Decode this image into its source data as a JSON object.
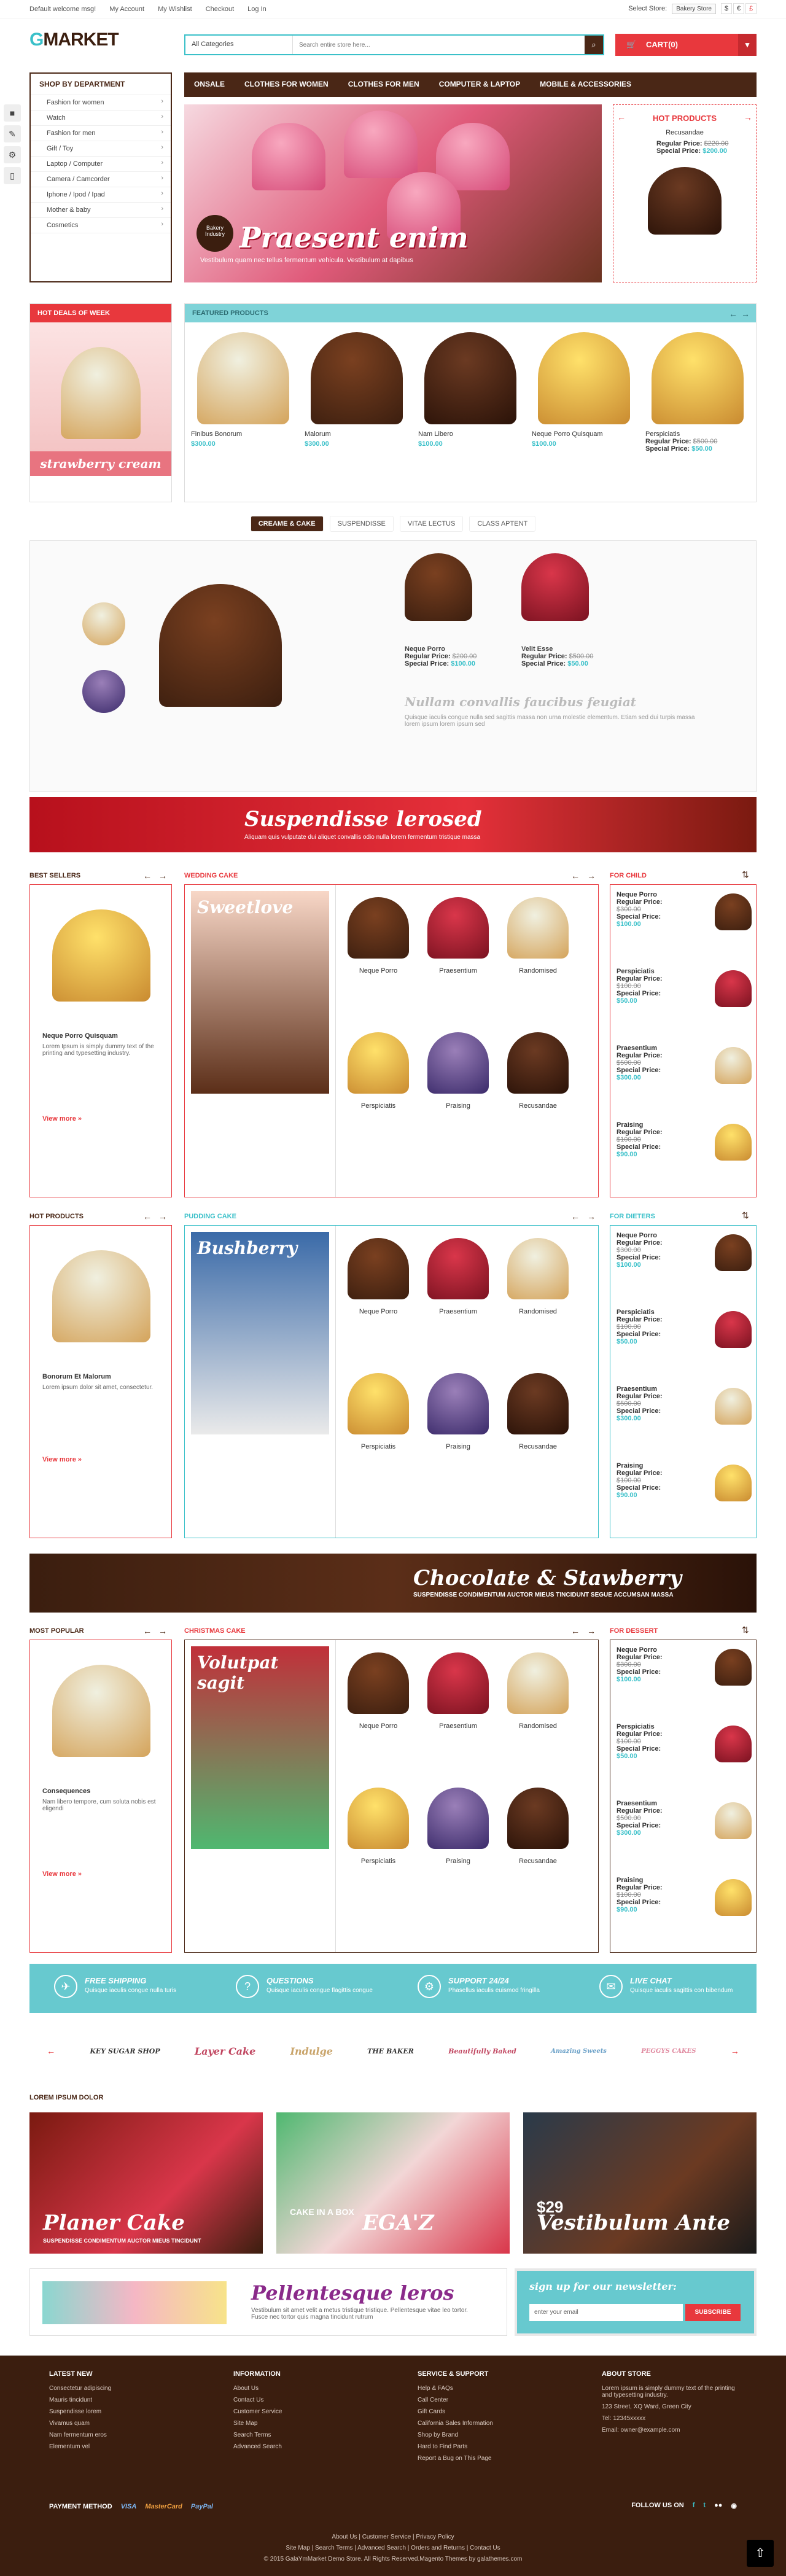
{
  "topbar": {
    "welcome": "Default welcome msg!",
    "my_account": "My Account",
    "my_wishlist": "My Wishlist",
    "checkout": "Checkout",
    "login": "Log In",
    "select_store": "Select Store:",
    "store_value": "Bakery Store",
    "currencies": [
      "$",
      "€",
      "£"
    ]
  },
  "header": {
    "logo": "MARKET",
    "logo_g": "G",
    "category": "All Categories",
    "search_placeholder": "Search entire store here...",
    "cart": "CART(0)"
  },
  "sidebar": {
    "title": "SHOP BY DEPARTMENT",
    "items": [
      "Fashion for women",
      "Watch",
      "Fashion for men",
      "Gift / Toy",
      "Laptop / Computer",
      "Camera / Camcorder",
      "Iphone / Ipod / Ipad",
      "Mother & baby",
      "Cosmetics"
    ]
  },
  "nav": {
    "items": [
      "ONSALE",
      "CLOTHES FOR WOMEN",
      "CLOTHES FOR MEN",
      "COMPUTER & LAPTOP",
      "MOBILE & ACCESSORIES"
    ]
  },
  "slider": {
    "title": "Praesent enim",
    "subtitle": "Vestibulum quam nec tellus fermentum vehicula. Vestibulum at dapibus",
    "badge": "Bakery Industry"
  },
  "hot_products": {
    "title": "HOT PRODUCTS",
    "product": "Recusandae",
    "regular_label": "Regular Price:",
    "regular": "$220.00",
    "special_label": "Special Price:",
    "special": "$200.00"
  },
  "deals": {
    "title": "HOT DEALS OF WEEK",
    "label": "strawberry cream"
  },
  "featured": {
    "title": "FEATURED PRODUCTS",
    "products": [
      {
        "name": "Finibus Bonorum",
        "price": "$300.00"
      },
      {
        "name": "Malorum",
        "price": "$300.00"
      },
      {
        "name": "Nam Libero",
        "price": "$100.00"
      },
      {
        "name": "Neque Porro Quisquam",
        "price": "$100.00"
      },
      {
        "name": "Perspiciatis",
        "regular": "$500.00",
        "special": "$50.00"
      }
    ]
  },
  "tabs": [
    "CREAME & CAKE",
    "SUSPENDISSE",
    "VITAE LECTUS",
    "CLASS APTENT"
  ],
  "tabbox": {
    "p1": {
      "name": "Neque Porro",
      "regular": "$200.00",
      "special": "$100.00"
    },
    "p2": {
      "name": "Velit Esse",
      "regular": "$500.00",
      "special": "$50.00"
    },
    "title": "Nullam convallis faucibus feugiat",
    "text": "Quisque iaculis congue nulla sed sagittis massa non urna molestie elementum. Etiam sed dui turpis massa lorem ipsum lorem ipsum sed"
  },
  "banner1": {
    "title": "Suspendisse lerosed",
    "subtitle": "Aliquam quis vulputate dui aliquet convallis odio nulla lorem fermentum tristique massa"
  },
  "blocks": [
    {
      "side_title": "BEST SELLERS",
      "side_name": "Neque Porro Quisquam",
      "side_text": "Lorem Ipsum is simply dummy text of the printing and typesetting industry.",
      "mid_title": "WEDDING CAKE",
      "tall_title": "Sweetlove",
      "grid": [
        "Neque Porro",
        "Praesentium",
        "Randomised",
        "Perspiciatis",
        "Praising",
        "Recusandae"
      ],
      "right_title": "FOR CHILD"
    },
    {
      "side_title": "HOT PRODUCTS",
      "side_name": "Bonorum Et Malorum",
      "side_text": "Lorem ipsum dolor sit amet, consectetur.",
      "mid_title": "PUDDING CAKE",
      "tall_title": "Bushberry",
      "grid": [
        "Neque Porro",
        "Praesentium",
        "Randomised",
        "Perspiciatis",
        "Praising",
        "Recusandae"
      ],
      "right_title": "FOR DIETERS"
    },
    {
      "side_title": "MOST POPULAR",
      "side_name": "Consequences",
      "side_text": "Nam libero tempore, cum soluta nobis est eligendi",
      "mid_title": "CHRISTMAS CAKE",
      "tall_title": "Volutpat sagit",
      "grid": [
        "Neque Porro",
        "Praesentium",
        "Randomised",
        "Perspiciatis",
        "Praising",
        "Recusandae"
      ],
      "right_title": "FOR DESSERT"
    }
  ],
  "view_more": "View more »",
  "right_items": [
    {
      "name": "Neque Porro",
      "regular": "$300.00",
      "special": "$100.00"
    },
    {
      "name": "Perspiciatis",
      "regular": "$100.00",
      "special": "$50.00"
    },
    {
      "name": "Praesentium",
      "regular": "$500.00",
      "special": "$300.00"
    },
    {
      "name": "Praising",
      "regular": "$100.00",
      "special": "$90.00"
    }
  ],
  "banner2": {
    "title": "Chocolate & Stawberry",
    "subtitle": "SUSPENDISSE CONDIMENTUM AUCTOR MIEUS TINCIDUNT SEGUE ACCUMSAN MASSA"
  },
  "service": [
    {
      "title": "FREE SHIPPING",
      "text": "Quisque iaculis congue nulla turis"
    },
    {
      "title": "QUESTIONS",
      "text": "Quisque iaculis congue flagittis congue"
    },
    {
      "title": "SUPPORT 24/24",
      "text": "Phasellus iaculis euismod fringilla"
    },
    {
      "title": "LIVE CHAT",
      "text": "Quisque iaculis sagittis con bibendum"
    }
  ],
  "brands": [
    "KEY SUGAR SHOP",
    "Layer Cake",
    "Indulge",
    "THE BAKER",
    "Beautifully Baked",
    "Amazing Sweets",
    "PEGGYS CAKES"
  ],
  "lorem_title": "LOREM IPSUM DOLOR",
  "promo": [
    {
      "title": "Planer Cake",
      "subtitle": "SUSPENDISSE CONDIMENTUM AUCTOR MIEUS TINCIDUNT"
    },
    {
      "title": "EGA'Z",
      "subtitle": "CAKE IN A BOX"
    },
    {
      "title": "Vestibulum Ante",
      "subtitle": "$29"
    }
  ],
  "pellentesque": {
    "title": "Pellentesque leros",
    "text": "Vestibulum sit amet velit a metus tristique tristique. Pellentesque vitae leo tortor. Fusce nec tortor quis magna tincidunt rutrum"
  },
  "newsletter": {
    "title": "sign up for our newsletter:",
    "placeholder": "enter your email",
    "button": "SUBSCRIBE"
  },
  "footer": {
    "latest": {
      "title": "LATEST NEW",
      "items": [
        "Consectetur adipiscing",
        "Mauris tincidunt",
        "Suspendisse lorem",
        "Vivamus quam",
        "Nam fermentum eros",
        "Elementum vel"
      ]
    },
    "info": {
      "title": "INFORMATION",
      "items": [
        "About Us",
        "Contact Us",
        "Customer Service",
        "Site Map",
        "Search Terms",
        "Advanced Search"
      ]
    },
    "service": {
      "title": "SERVICE & SUPPORT",
      "items": [
        "Help & FAQs",
        "Call Center",
        "Gift Cards",
        "California Sales Information",
        "Shop by Brand",
        "Hard to Find Parts",
        "Report a Bug on This Page"
      ]
    },
    "about": {
      "title": "ABOUT STORE",
      "text": "Lorem ipsum is simply dummy text of the printing and typesetting industry.",
      "address": "123 Street, XQ Ward, Green City",
      "tel": "Tel: 12345xxxxx",
      "email": "Email: owner@example.com"
    },
    "payment": "PAYMENT METHOD",
    "pay_items": [
      "VISA",
      "MasterCard",
      "PayPal"
    ],
    "follow": "FOLLOW US ON",
    "links1": "About Us  |  Customer Service  |  Privacy Policy",
    "links2": "Site Map  |  Search Terms  |  Advanced Search  |  Orders and Returns  |  Contact Us",
    "copyright": "© 2015 GalaYmMarket Demo Store. All Rights Reserved.Magento Themes by galathemes.com"
  }
}
